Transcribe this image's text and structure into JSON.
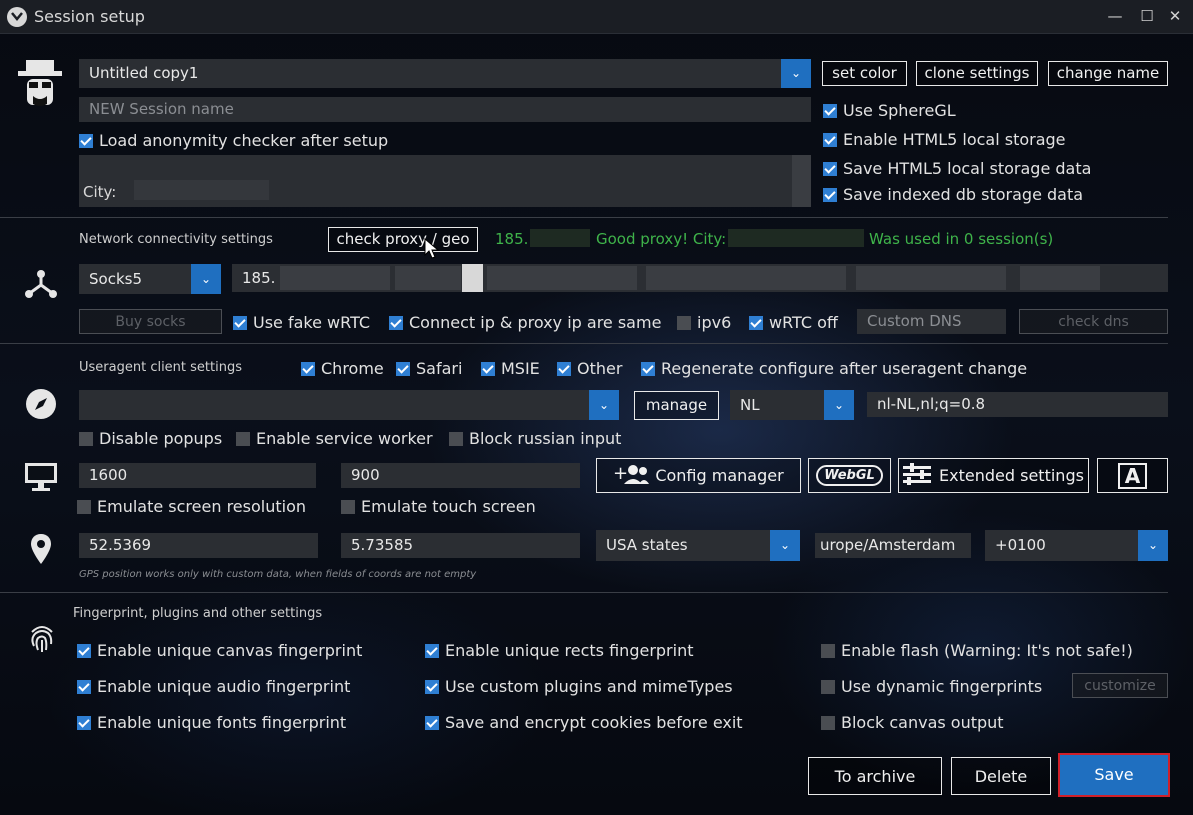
{
  "window": {
    "title": "Session setup",
    "minimize": "—",
    "maximize": "☐",
    "close": "✕"
  },
  "session": {
    "name_value": "Untitled copy1",
    "new_name_placeholder": "NEW Session name",
    "load_checker_label": "Load anonymity checker after setup",
    "city_label": "City:",
    "set_color": "set color",
    "clone_settings": "clone settings",
    "change_name": "change name",
    "use_spheregl": "Use SphereGL",
    "enable_html5": "Enable HTML5 local storage",
    "save_html5": "Save HTML5 local storage data",
    "save_indexeddb": "Save indexed db storage data"
  },
  "network": {
    "section_label": "Network connectivity settings",
    "check_proxy": "check proxy / geo",
    "status_ip": "185.",
    "status_good": "Good proxy! City:",
    "status_used": "Was used in 0 session(s)",
    "proxy_type": "Socks5",
    "proxy_value": "185.",
    "buy_socks": "Buy socks",
    "fake_wrtc": "Use fake wRTC",
    "connect_same": "Connect ip & proxy ip are same",
    "ipv6": "ipv6",
    "wrtc_off": "wRTC off",
    "custom_dns_placeholder": "Custom DNS",
    "check_dns": "check dns"
  },
  "useragent": {
    "section_label": "Useragent client settings",
    "chrome": "Chrome",
    "safari": "Safari",
    "msie": "MSIE",
    "other": "Other",
    "regenerate": "Regenerate configure after useragent change",
    "ua_value": "",
    "manage": "manage",
    "lang": "NL",
    "accept_lang": "nl-NL,nl;q=0.8",
    "disable_popups": "Disable popups",
    "service_worker": "Enable service worker",
    "block_russian": "Block russian input"
  },
  "screen": {
    "width": "1600",
    "height": "900",
    "config_manager": "Config manager",
    "webgl": "WebGL",
    "extended_settings": "Extended settings",
    "font_btn": "A",
    "emulate_resolution": "Emulate screen resolution",
    "emulate_touch": "Emulate touch screen"
  },
  "geo": {
    "lat": "52.5369",
    "lon": "5.73585",
    "region": "USA states",
    "timezone": "urope/Amsterdam",
    "offset": "+0100",
    "note": "GPS position works only with custom data, when fields of coords are not empty"
  },
  "fingerprint": {
    "section_label": "Fingerprint, plugins and other settings",
    "canvas": "Enable unique canvas fingerprint",
    "audio": "Enable unique audio fingerprint",
    "fonts": "Enable unique fonts fingerprint",
    "rects": "Enable unique rects fingerprint",
    "plugins": "Use custom plugins and mimeTypes",
    "cookies": "Save and encrypt cookies before exit",
    "flash": "Enable flash (Warning: It's not safe!)",
    "dynamic": "Use dynamic fingerprints",
    "customize": "customize",
    "block_canvas": "Block canvas output"
  },
  "actions": {
    "archive": "To archive",
    "delete": "Delete",
    "save": "Save"
  },
  "colors": {
    "accent": "#2f7fd3",
    "save_bg": "#1f6fc0",
    "save_border": "#d0202a",
    "good": "#3fb34a"
  }
}
